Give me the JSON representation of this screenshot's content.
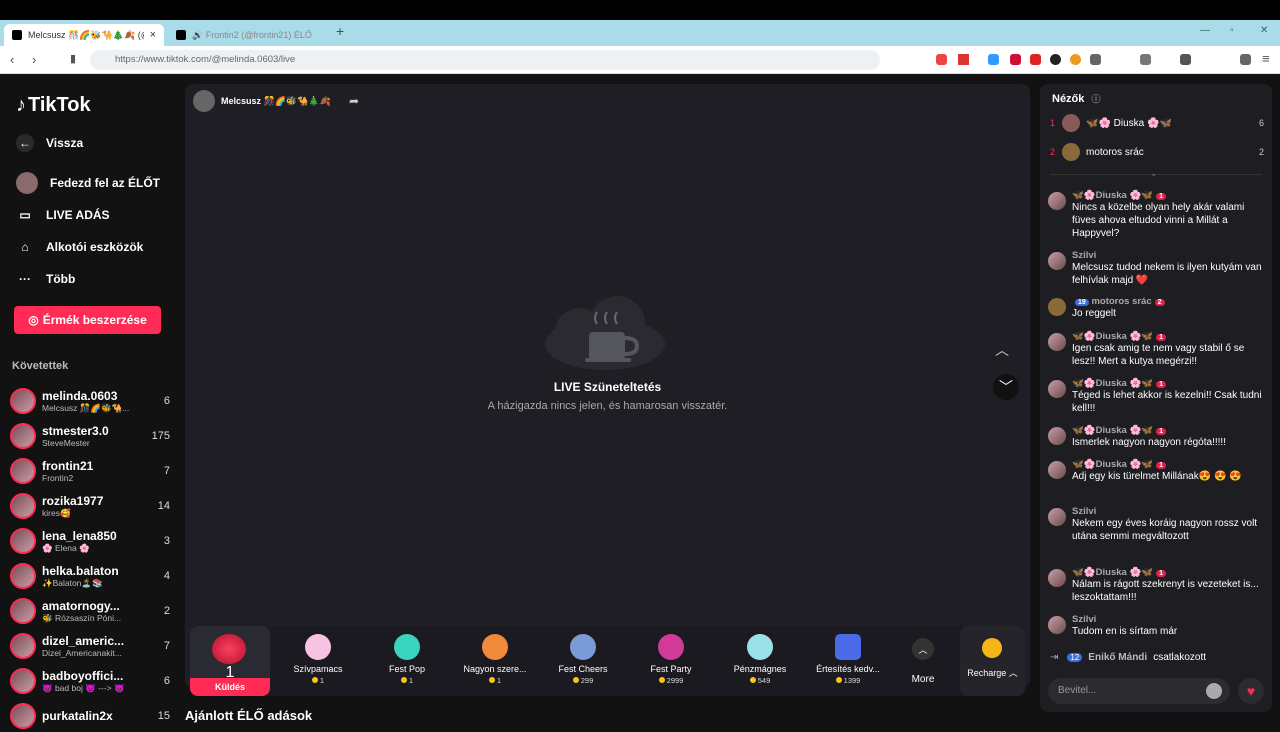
{
  "browser": {
    "tabs": [
      {
        "title": "Melcsusz 🎊🌈🐝🐪🎄🍂 (@"
      },
      {
        "title": "🔊 Frontin2 (@frontin21) ÉLŐ adás"
      }
    ],
    "new_tab": "+",
    "url": "https://www.tiktok.com/@melinda.0603/live"
  },
  "sidebar": {
    "logo": "TikTok",
    "back": "Vissza",
    "items": [
      {
        "label": "Fedezd fel az ÉLŐT"
      },
      {
        "label": "LIVE ADÁS"
      },
      {
        "label": "Alkotói eszközök"
      },
      {
        "label": "Több"
      }
    ],
    "coins_button": "Érmék beszerzése",
    "following_header": "Követettek",
    "following": [
      {
        "name": "melinda.0603",
        "sub": "Melcsusz 🎊🌈🐝🐪...",
        "count": "6"
      },
      {
        "name": "stmester3.0",
        "sub": "SteveMester",
        "count": "175"
      },
      {
        "name": "frontin21",
        "sub": "Frontin2",
        "count": "7"
      },
      {
        "name": "rozika1977",
        "sub": "kires🥰",
        "count": "14"
      },
      {
        "name": "lena_lena850",
        "sub": "🌸 Elena 🌸",
        "count": "3"
      },
      {
        "name": "helka.balaton",
        "sub": "✨Balaton🏝️📚",
        "count": "4"
      },
      {
        "name": "amatornogy...",
        "sub": "🐝 Rózsaszín Póni...",
        "count": "2"
      },
      {
        "name": "dizel_americ...",
        "sub": "Dizel_Americanakit...",
        "count": "7"
      },
      {
        "name": "badboyoffici...",
        "sub": "😈 bad boj 😈 ---> 😈",
        "count": "6"
      },
      {
        "name": "purkatalin2x",
        "sub": "",
        "count": "15"
      }
    ]
  },
  "stream": {
    "host": "Melcsusz 🎊🌈🐝🐪🎄🍂",
    "paused_title": "LIVE Szüneteltetés",
    "paused_sub": "A házigazda nincs jelen, és hamarosan visszatér."
  },
  "gifts": {
    "selected": {
      "price": "1",
      "send": "Küldés"
    },
    "items": [
      {
        "name": "Szívpamacs",
        "price": "1"
      },
      {
        "name": "Fest Pop",
        "price": "1"
      },
      {
        "name": "Nagyon szere...",
        "price": "1"
      },
      {
        "name": "Fest Cheers",
        "price": "299"
      },
      {
        "name": "Fest Party",
        "price": "2999"
      },
      {
        "name": "Pénzmágnes",
        "price": "549"
      },
      {
        "name": "Értesítés kedv...",
        "price": "1399"
      }
    ],
    "more": "More",
    "recharge": "Recharge"
  },
  "recommended": "Ajánlott ÉLŐ adások",
  "chat": {
    "viewers_header": "Nézők",
    "viewers": [
      {
        "rank": "1",
        "name": "🦋🌸 Diuska 🌸🦋",
        "count": "6"
      },
      {
        "rank": "2",
        "name": "motoros srác",
        "count": "2"
      }
    ],
    "messages": [
      {
        "user": "🦋🌸Diuska 🌸🦋",
        "text": "Nincs a közelbe olyan hely akár valami füves ahova eltudod vinni a Millát a Happyvel?"
      },
      {
        "user": "Szilvi",
        "text": "Melcsusz tudod nekem is ilyen kutyám van felhívlak majd ❤️"
      },
      {
        "user": "motoros srác",
        "text": "Jo reggelt"
      },
      {
        "user": "🦋🌸Diuska 🌸🦋",
        "text": "Igen csak amig te nem vagy stabil ő se lesz!! Mert a kutya megérzi!!"
      },
      {
        "user": "🦋🌸Diuska 🌸🦋",
        "text": "Téged is lehet akkor is kezelni!! Csak tudni kell!!!"
      },
      {
        "user": "🦋🌸Diuska 🌸🦋",
        "text": "Ismerlek nagyon nagyon régóta!!!!!"
      },
      {
        "user": "🦋🌸Diuska 🌸🦋",
        "text": "Adj egy kis türelmet Millának😍 😍 😍"
      },
      {
        "user": "Szilvi",
        "text": "Nekem egy éves koráig nagyon rossz volt utána semmi megváltozott"
      },
      {
        "user": "🦋🌸Diuska 🌸🦋",
        "text": "Nálam is rágott szekrenyt is vezeteket is... leszoktattam!!!"
      },
      {
        "user": "Szilvi",
        "text": "Tudom en is sírtam már"
      }
    ],
    "joined_level": "12",
    "joined_user": "Enikő Mándi",
    "joined_text": "csatlakozott",
    "input_placeholder": "Bevitel..."
  }
}
